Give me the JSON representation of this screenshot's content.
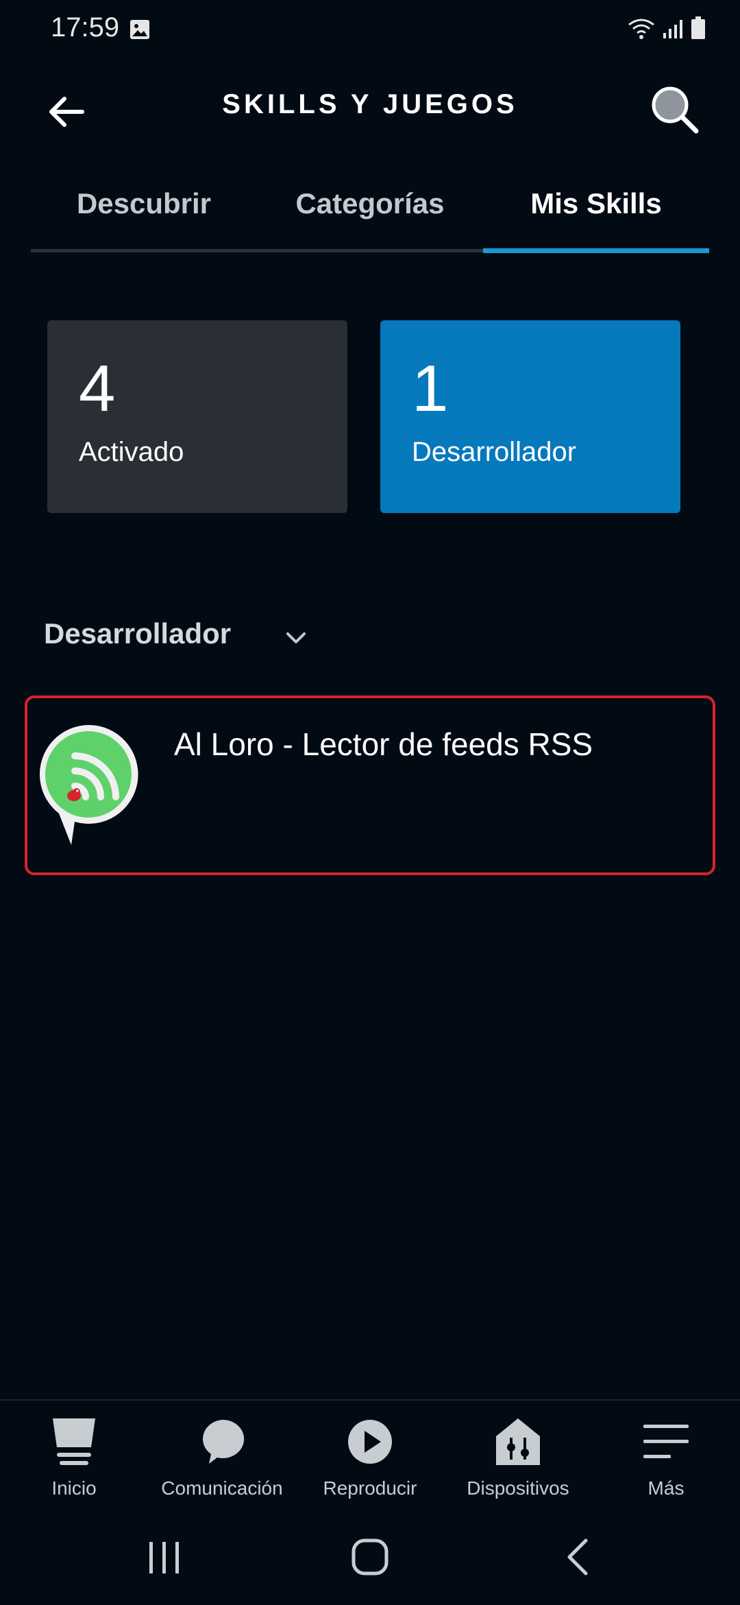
{
  "status_bar": {
    "time": "17:59"
  },
  "header": {
    "title": "SKILLS Y JUEGOS"
  },
  "tabs": [
    {
      "label": "Descubrir",
      "active": false
    },
    {
      "label": "Categorías",
      "active": false
    },
    {
      "label": "Mis Skills",
      "active": true
    }
  ],
  "cards": {
    "enabled": {
      "count": "4",
      "label": "Activado"
    },
    "developer": {
      "count": "1",
      "label": "Desarrollador"
    }
  },
  "section": {
    "title": "Desarrollador"
  },
  "skills": [
    {
      "name": "Al Loro - Lector de feeds RSS",
      "icon": "rss-parrot-icon"
    }
  ],
  "bottom_nav": [
    {
      "label": "Inicio",
      "icon": "home-icon"
    },
    {
      "label": "Comunicación",
      "icon": "chat-bubble-icon"
    },
    {
      "label": "Reproducir",
      "icon": "play-icon"
    },
    {
      "label": "Dispositivos",
      "icon": "devices-icon"
    },
    {
      "label": "Más",
      "icon": "menu-icon"
    }
  ],
  "colors": {
    "background": "#020b14",
    "accent": "#1a98d5",
    "developer_card": "#0679bd",
    "highlight_border": "#d8222e"
  }
}
